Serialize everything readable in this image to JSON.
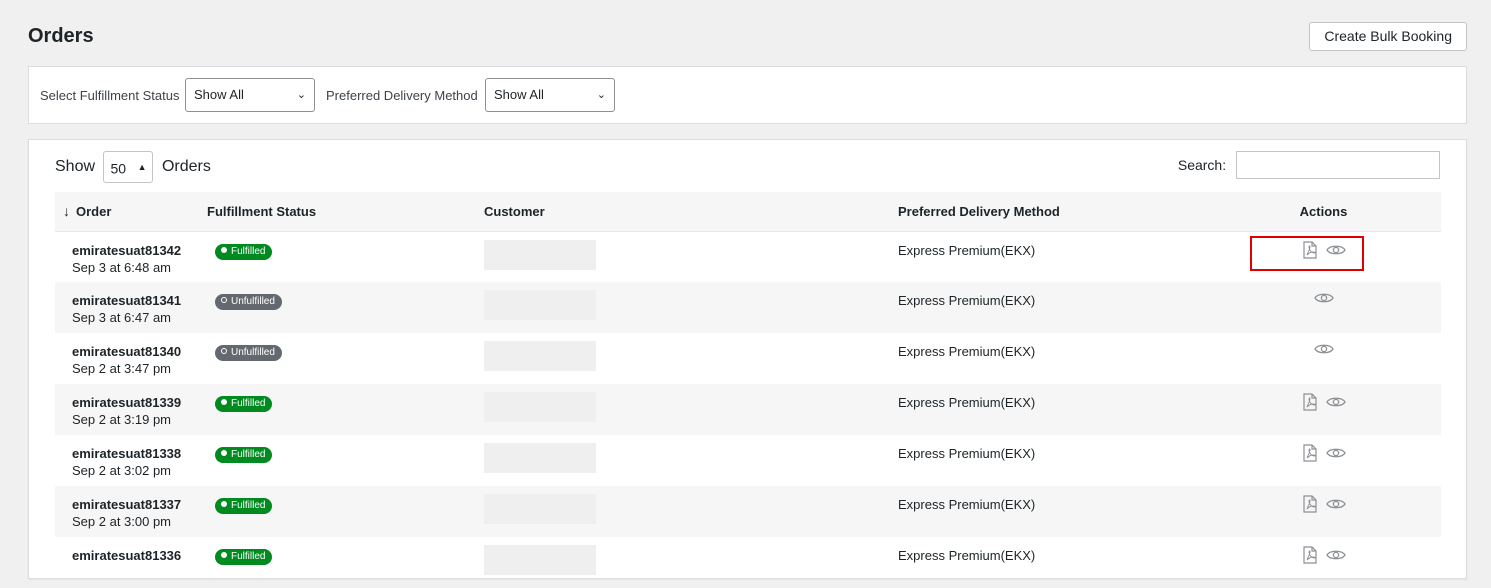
{
  "header": {
    "title": "Orders",
    "bulk_button": "Create Bulk Booking"
  },
  "filters": {
    "status_label": "Select Fulfillment Status",
    "status_value": "Show All",
    "delivery_label": "Preferred Delivery Method",
    "delivery_value": "Show All"
  },
  "table_controls": {
    "show_label": "Show",
    "page_length": "50",
    "orders_label": "Orders",
    "search_label": "Search:"
  },
  "columns": {
    "order": "Order",
    "status": "Fulfillment Status",
    "customer": "Customer",
    "method": "Preferred Delivery Method",
    "actions": "Actions"
  },
  "rows": [
    {
      "id": "emiratesuat81342",
      "date": "Sep 3 at 6:48 am",
      "status": "Fulfilled",
      "method": "Express Premium(EKX)",
      "has_pdf": true,
      "highlighted": true
    },
    {
      "id": "emiratesuat81341",
      "date": "Sep 3 at 6:47 am",
      "status": "Unfulfilled",
      "method": "Express Premium(EKX)",
      "has_pdf": false
    },
    {
      "id": "emiratesuat81340",
      "date": "Sep 2 at 3:47 pm",
      "status": "Unfulfilled",
      "method": "Express Premium(EKX)",
      "has_pdf": false
    },
    {
      "id": "emiratesuat81339",
      "date": "Sep 2 at 3:19 pm",
      "status": "Fulfilled",
      "method": "Express Premium(EKX)",
      "has_pdf": true
    },
    {
      "id": "emiratesuat81338",
      "date": "Sep 2 at 3:02 pm",
      "status": "Fulfilled",
      "method": "Express Premium(EKX)",
      "has_pdf": true
    },
    {
      "id": "emiratesuat81337",
      "date": "Sep 2 at 3:00 pm",
      "status": "Fulfilled",
      "method": "Express Premium(EKX)",
      "has_pdf": true
    },
    {
      "id": "emiratesuat81336",
      "date": "",
      "status": "Fulfilled",
      "method": "Express Premium(EKX)",
      "has_pdf": true
    }
  ],
  "icons": {
    "sort": "arrow-down-icon",
    "pdf": "pdf-file-icon",
    "view": "eye-icon",
    "dropdown": "chevron-down-icon"
  },
  "colors": {
    "fulfilled": "#008a20",
    "unfulfilled": "#646970",
    "highlight": "#e00000"
  }
}
